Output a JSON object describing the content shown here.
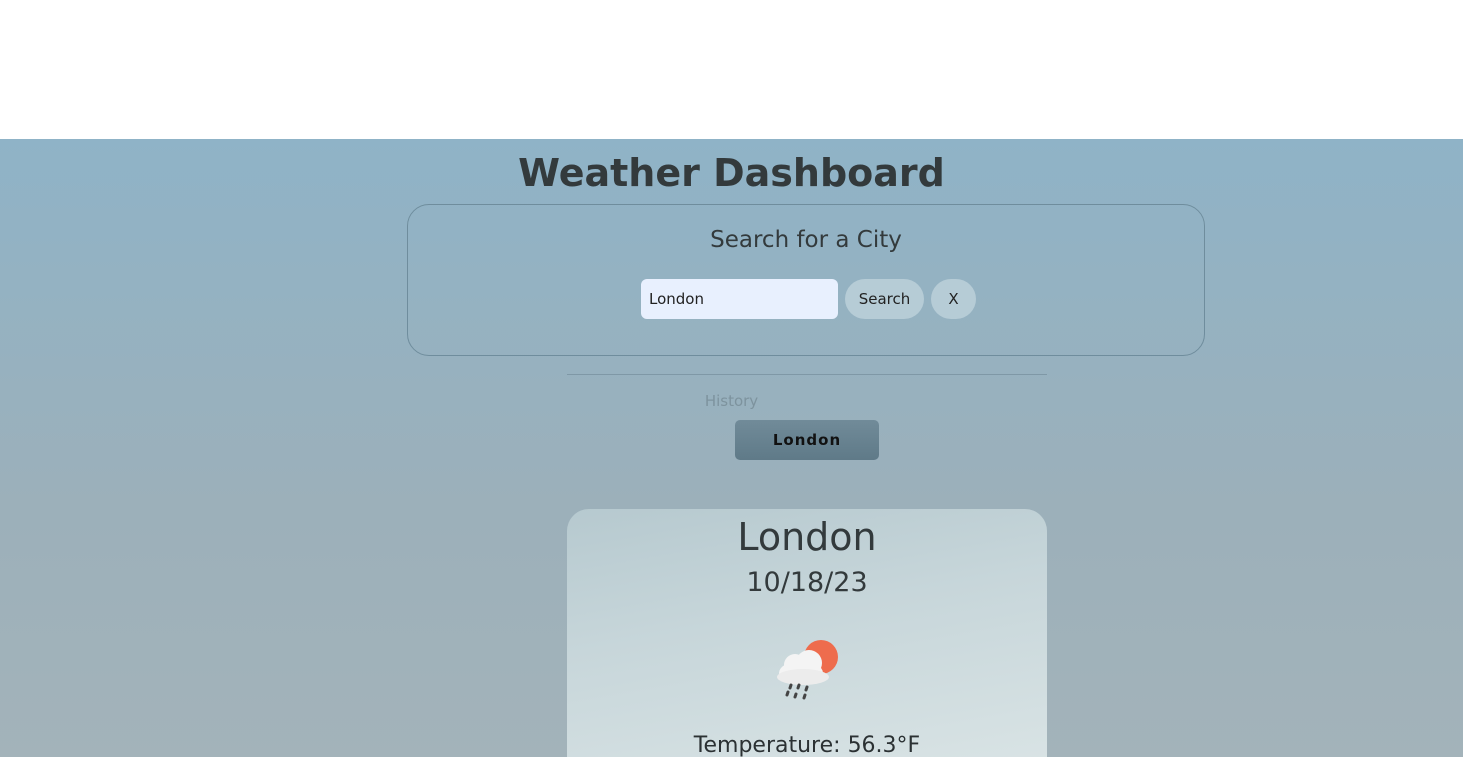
{
  "app": {
    "title": "Weather Dashboard"
  },
  "search": {
    "heading": "Search for a City",
    "input_value": "London",
    "search_label": "Search",
    "clear_label": "X"
  },
  "history": {
    "label": "History",
    "items": [
      {
        "label": "London"
      }
    ]
  },
  "current": {
    "city": "London",
    "date": "10/18/23",
    "icon": "rain-cloud-sun-icon",
    "temperature_label": "Temperature:",
    "temperature_value": "56.3°F"
  },
  "colors": {
    "background_top": "#8fb3c7",
    "background_bottom": "#a3b3ba",
    "accent_button": "#b6ccd6",
    "history_button": "#718b99",
    "sun": "#ee6c4d"
  }
}
